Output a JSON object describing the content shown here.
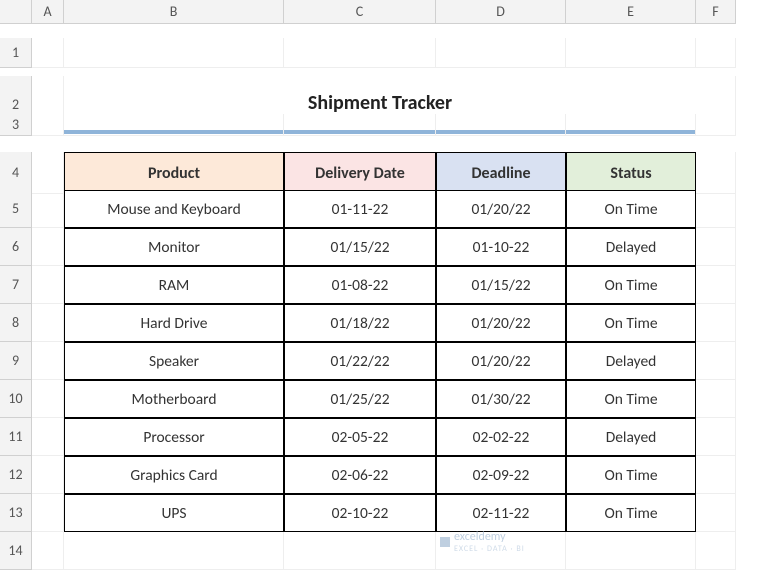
{
  "cols": [
    "A",
    "B",
    "C",
    "D",
    "E",
    "F"
  ],
  "rows": [
    "1",
    "2",
    "3",
    "4",
    "5",
    "6",
    "7",
    "8",
    "9",
    "10",
    "11",
    "12",
    "13",
    "14"
  ],
  "title": "Shipment Tracker",
  "headers": {
    "product": "Product",
    "delivery": "Delivery Date",
    "deadline": "Deadline",
    "status": "Status"
  },
  "data": [
    {
      "product": "Mouse and Keyboard",
      "delivery": "01-11-22",
      "deadline": "01/20/22",
      "status": "On Time"
    },
    {
      "product": "Monitor",
      "delivery": "01/15/22",
      "deadline": "01-10-22",
      "status": "Delayed"
    },
    {
      "product": "RAM",
      "delivery": "01-08-22",
      "deadline": "01/15/22",
      "status": "On Time"
    },
    {
      "product": "Hard Drive",
      "delivery": "01/18/22",
      "deadline": "01/20/22",
      "status": "On Time"
    },
    {
      "product": "Speaker",
      "delivery": "01/22/22",
      "deadline": "01/20/22",
      "status": "Delayed"
    },
    {
      "product": "Motherboard",
      "delivery": "01/25/22",
      "deadline": "01/30/22",
      "status": "On Time"
    },
    {
      "product": "Processor",
      "delivery": "02-05-22",
      "deadline": "02-02-22",
      "status": "Delayed"
    },
    {
      "product": "Graphics Card",
      "delivery": "02-06-22",
      "deadline": "02-09-22",
      "status": "On Time"
    },
    {
      "product": "UPS",
      "delivery": "02-10-22",
      "deadline": "02-11-22",
      "status": "On Time"
    }
  ],
  "watermark": {
    "brand": "exceldemy",
    "sub": "EXCEL · DATA · BI"
  }
}
